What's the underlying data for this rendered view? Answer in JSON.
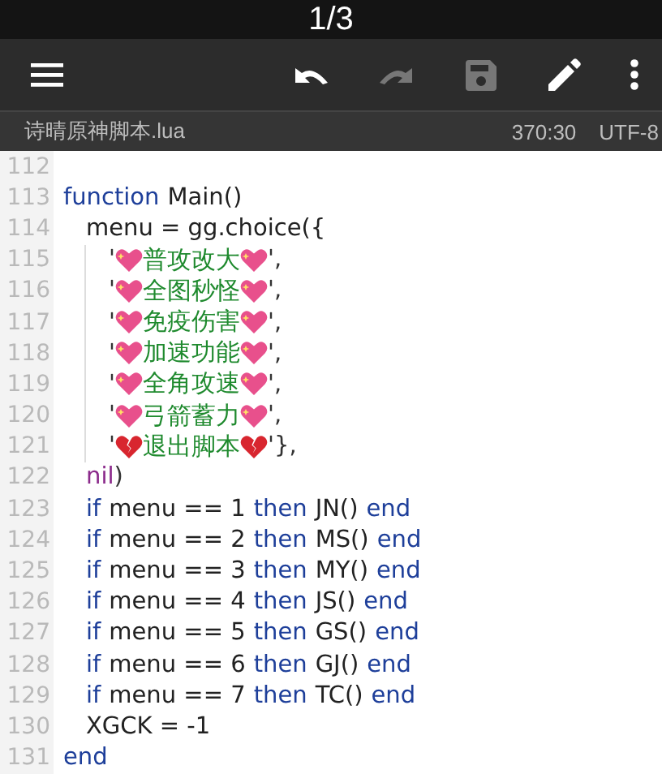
{
  "status_bar": {
    "page_indicator": "1/3"
  },
  "toolbar": {
    "buttons": [
      {
        "kind": "menu",
        "disabled": false
      },
      {
        "kind": "undo",
        "disabled": false
      },
      {
        "kind": "redo",
        "disabled": true
      },
      {
        "kind": "save",
        "disabled": true
      },
      {
        "kind": "edit",
        "disabled": false
      },
      {
        "kind": "more",
        "disabled": false
      }
    ]
  },
  "file_bar": {
    "file_name": "诗晴原神脚本.lua",
    "cursor_position": "370:30",
    "encoding": "UTF-8"
  },
  "editor": {
    "lines": [
      {
        "number": "112"
      },
      {
        "number": "113",
        "tokens": [
          {
            "kind": "kw",
            "text": "function"
          },
          {
            "kind": "id",
            "text": "Main()"
          }
        ],
        "children": [
          {
            "number": "114",
            "tokens": [
              {
                "kind": "id",
                "text": "menu = gg.choice({"
              }
            ],
            "children": [
              {
                "number": "115",
                "tokens": [
                  {
                    "kind": "op",
                    "text": "'"
                  },
                  {
                    "kind": "heart"
                  },
                  {
                    "kind": "str",
                    "text": "普攻改大"
                  },
                  {
                    "kind": "heart"
                  },
                  {
                    "kind": "op",
                    "text": "',"
                  }
                ]
              },
              {
                "number": "116",
                "tokens": [
                  {
                    "kind": "op",
                    "text": "'"
                  },
                  {
                    "kind": "heart"
                  },
                  {
                    "kind": "str",
                    "text": "全图秒怪"
                  },
                  {
                    "kind": "heart"
                  },
                  {
                    "kind": "op",
                    "text": "',"
                  }
                ]
              },
              {
                "number": "117",
                "tokens": [
                  {
                    "kind": "op",
                    "text": "'"
                  },
                  {
                    "kind": "heart"
                  },
                  {
                    "kind": "str",
                    "text": "免疫伤害"
                  },
                  {
                    "kind": "heart"
                  },
                  {
                    "kind": "op",
                    "text": "',"
                  }
                ]
              },
              {
                "number": "118",
                "tokens": [
                  {
                    "kind": "op",
                    "text": "'"
                  },
                  {
                    "kind": "heart"
                  },
                  {
                    "kind": "str",
                    "text": "加速功能"
                  },
                  {
                    "kind": "heart"
                  },
                  {
                    "kind": "op",
                    "text": "',"
                  }
                ]
              },
              {
                "number": "119",
                "tokens": [
                  {
                    "kind": "op",
                    "text": "'"
                  },
                  {
                    "kind": "heart"
                  },
                  {
                    "kind": "str",
                    "text": "全角攻速"
                  },
                  {
                    "kind": "heart"
                  },
                  {
                    "kind": "op",
                    "text": "',"
                  }
                ]
              },
              {
                "number": "120",
                "tokens": [
                  {
                    "kind": "op",
                    "text": "'"
                  },
                  {
                    "kind": "heart"
                  },
                  {
                    "kind": "str",
                    "text": "弓箭蓄力"
                  },
                  {
                    "kind": "heart"
                  },
                  {
                    "kind": "op",
                    "text": "',"
                  }
                ]
              },
              {
                "number": "121",
                "tokens": [
                  {
                    "kind": "op",
                    "text": "'"
                  },
                  {
                    "kind": "broken-heart"
                  },
                  {
                    "kind": "str",
                    "text": "退出脚本"
                  },
                  {
                    "kind": "broken-heart"
                  },
                  {
                    "kind": "op",
                    "text": "'},"
                  }
                ]
              }
            ]
          },
          {
            "number": "122",
            "tokens": [
              {
                "kind": "nil",
                "text": "nil"
              },
              {
                "kind": "op",
                "text": ")"
              }
            ]
          },
          {
            "number": "123",
            "tokens": [
              {
                "kind": "kw",
                "text": "if"
              },
              {
                "kind": "id",
                "text": "menu == 1"
              },
              {
                "kind": "kw",
                "text": "then"
              },
              {
                "kind": "id",
                "text": "JN()"
              },
              {
                "kind": "kw",
                "text": "end"
              }
            ]
          },
          {
            "number": "124",
            "tokens": [
              {
                "kind": "kw",
                "text": "if"
              },
              {
                "kind": "id",
                "text": "menu == 2"
              },
              {
                "kind": "kw",
                "text": "then"
              },
              {
                "kind": "id",
                "text": "MS()"
              },
              {
                "kind": "kw",
                "text": "end"
              }
            ]
          },
          {
            "number": "125",
            "tokens": [
              {
                "kind": "kw",
                "text": "if"
              },
              {
                "kind": "id",
                "text": "menu == 3"
              },
              {
                "kind": "kw",
                "text": "then"
              },
              {
                "kind": "id",
                "text": "MY()"
              },
              {
                "kind": "kw",
                "text": "end"
              }
            ]
          },
          {
            "number": "126",
            "tokens": [
              {
                "kind": "kw",
                "text": "if"
              },
              {
                "kind": "id",
                "text": "menu == 4"
              },
              {
                "kind": "kw",
                "text": "then"
              },
              {
                "kind": "id",
                "text": "JS()"
              },
              {
                "kind": "kw",
                "text": "end"
              }
            ]
          },
          {
            "number": "127",
            "tokens": [
              {
                "kind": "kw",
                "text": "if"
              },
              {
                "kind": "id",
                "text": "menu == 5"
              },
              {
                "kind": "kw",
                "text": "then"
              },
              {
                "kind": "id",
                "text": "GS()"
              },
              {
                "kind": "kw",
                "text": "end"
              }
            ]
          },
          {
            "number": "128",
            "tokens": [
              {
                "kind": "kw",
                "text": "if"
              },
              {
                "kind": "id",
                "text": "menu == 6"
              },
              {
                "kind": "kw",
                "text": "then"
              },
              {
                "kind": "id",
                "text": "GJ()"
              },
              {
                "kind": "kw",
                "text": "end"
              }
            ]
          },
          {
            "number": "129",
            "tokens": [
              {
                "kind": "kw",
                "text": "if"
              },
              {
                "kind": "id",
                "text": "menu == 7"
              },
              {
                "kind": "kw",
                "text": "then"
              },
              {
                "kind": "id",
                "text": "TC()"
              },
              {
                "kind": "kw",
                "text": "end"
              }
            ]
          },
          {
            "number": "130",
            "tokens": [
              {
                "kind": "id",
                "text": "XGCK = -1"
              }
            ]
          }
        ]
      },
      {
        "number": "131",
        "tokens": [
          {
            "kind": "kw",
            "text": "end"
          }
        ]
      }
    ]
  }
}
